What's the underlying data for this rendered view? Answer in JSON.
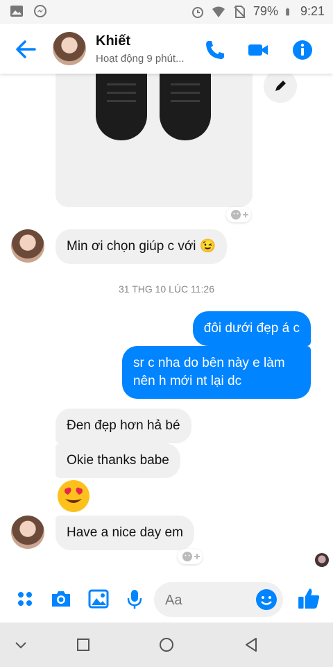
{
  "status_bar": {
    "battery": "79%",
    "time": "9:21"
  },
  "header": {
    "contact_name": "Khiết",
    "status_text": "Hoạt động 9 phút..."
  },
  "messages": {
    "in1": "Min ơi chọn giúp c với 😉",
    "timestamp": "31 THG 10 LÚC 11:26",
    "out1": "đôi dưới đẹp á c",
    "out2_line1": "sr c nha do bên này e làm",
    "out2_line2": "nên h mới nt lại dc",
    "in2": "Đen đẹp hơn hả bé",
    "in3": "Okie thanks babe",
    "in4": "Have a nice day em"
  },
  "composer": {
    "placeholder": "Aa"
  },
  "colors": {
    "accent": "#0084ff",
    "bubble_in": "#f1f0f0",
    "like": "#0084ff"
  }
}
